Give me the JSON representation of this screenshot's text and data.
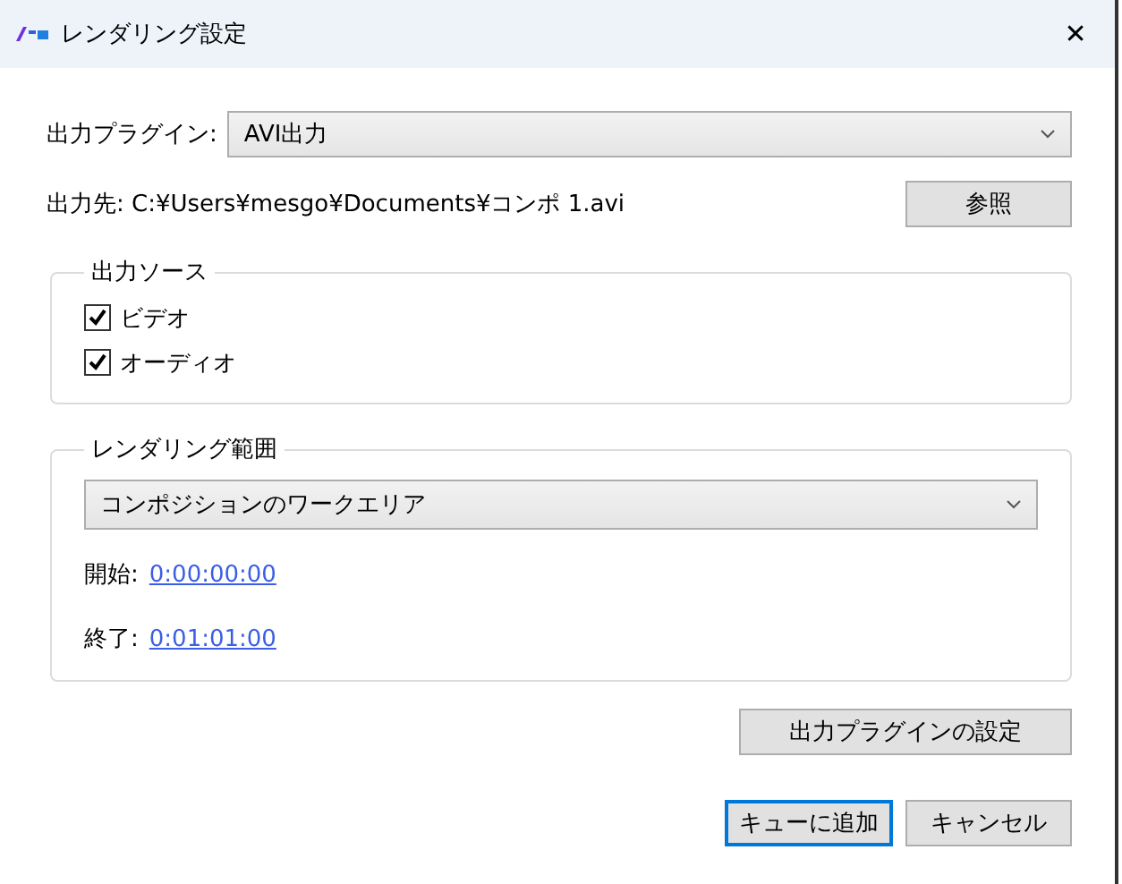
{
  "window": {
    "title": "レンダリング設定",
    "close": "✕"
  },
  "plugin": {
    "label": "出力プラグイン:",
    "value": "AVI出力"
  },
  "output": {
    "label": "出力先:",
    "path": "C:¥Users¥mesgo¥Documents¥コンポ 1.avi",
    "browse": "参照"
  },
  "source": {
    "title": "出力ソース",
    "items": [
      {
        "label": "ビデオ",
        "checked": true
      },
      {
        "label": "オーディオ",
        "checked": true
      }
    ]
  },
  "range": {
    "title": "レンダリング範囲",
    "value": "コンポジションのワークエリア",
    "start_label": "開始:",
    "start": "0:00:00:00",
    "end_label": "終了:",
    "end": "0:01:01:00"
  },
  "plugin_settings": "出力プラグインの設定",
  "buttons": [
    {
      "label": "キューに追加",
      "default": true
    },
    {
      "label": "キャンセル",
      "default": false
    }
  ]
}
